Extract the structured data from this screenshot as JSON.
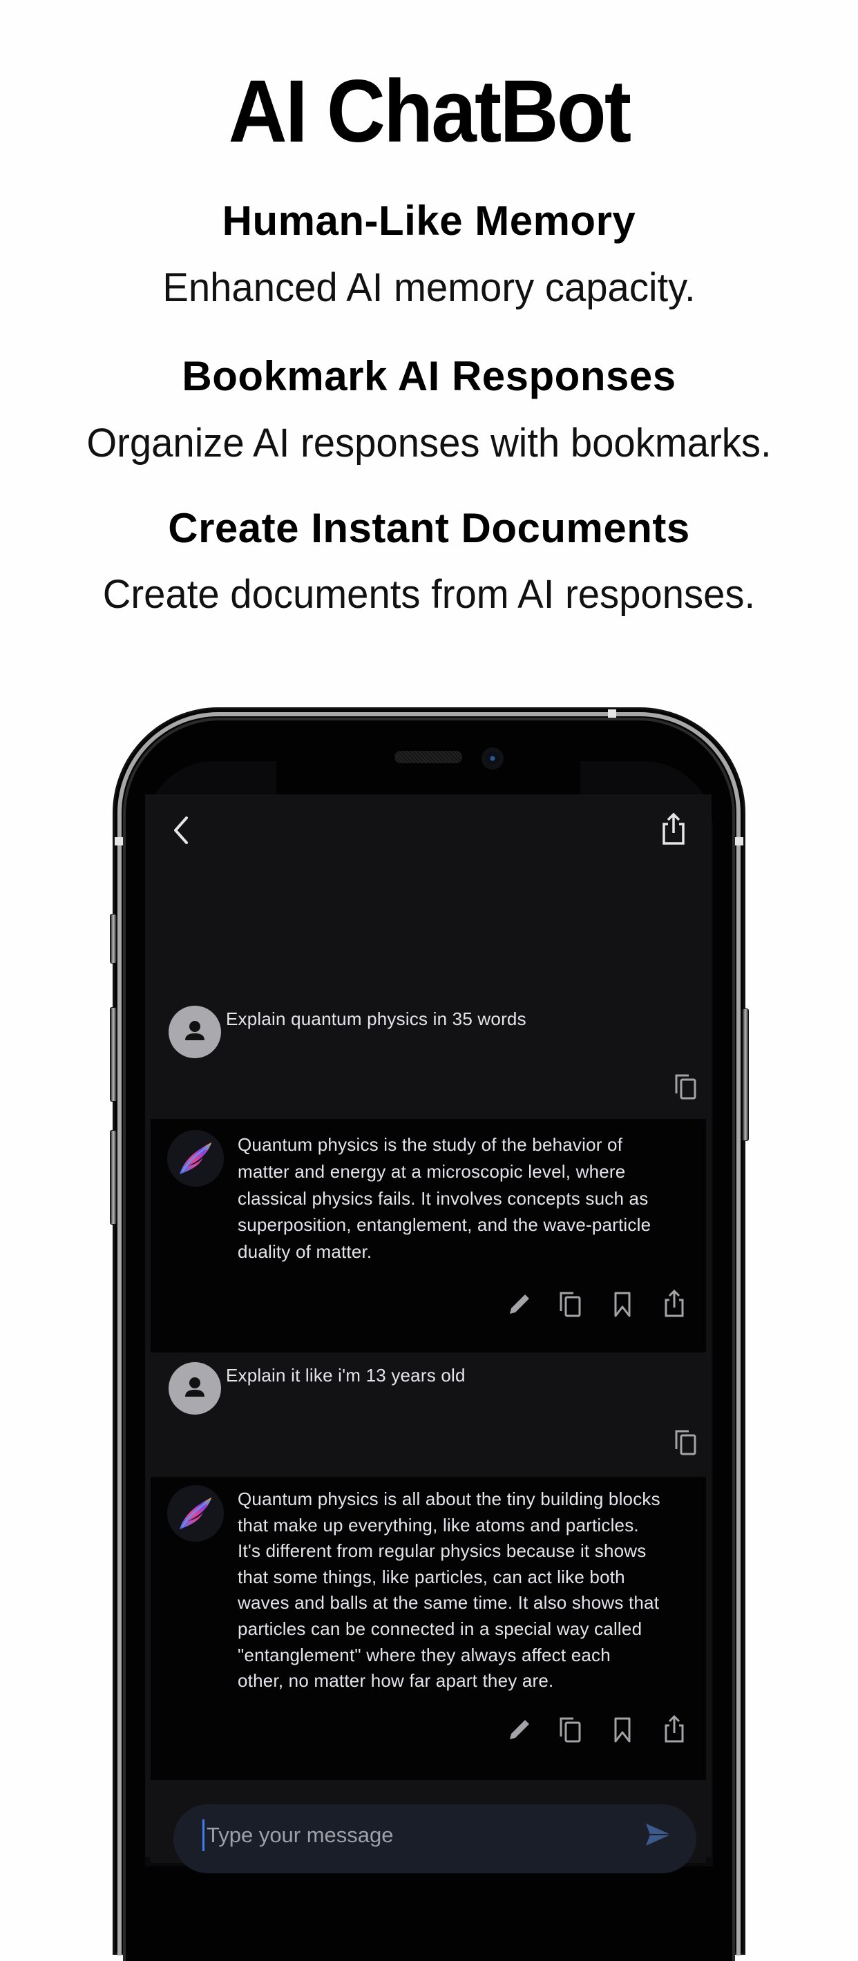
{
  "promo": {
    "title": "AI ChatBot",
    "features": [
      {
        "heading": "Human-Like Memory",
        "description": "Enhanced AI memory capacity."
      },
      {
        "heading": "Bookmark AI Responses",
        "description": "Organize AI responses with bookmarks."
      },
      {
        "heading": "Create Instant Documents",
        "description": "Create documents from AI responses."
      }
    ]
  },
  "app": {
    "nav": {
      "back_icon": "chevron-left-icon",
      "share_icon": "share-icon"
    },
    "messages": [
      {
        "role": "user",
        "text": "Explain quantum physics in 35 words",
        "actions": [
          "copy"
        ]
      },
      {
        "role": "assistant",
        "lines": [
          "Quantum physics is the study of the behavior of",
          "matter and energy at a microscopic level, where",
          "classical physics fails. It involves concepts such as",
          "superposition, entanglement, and the wave-particle",
          "duality of matter."
        ],
        "actions": [
          "edit",
          "copy",
          "bookmark",
          "share"
        ]
      },
      {
        "role": "user",
        "text": "Explain it like i'm 13 years old",
        "actions": [
          "copy"
        ]
      },
      {
        "role": "assistant",
        "lines": [
          "Quantum physics is all about the tiny building blocks",
          "that make up everything, like atoms and particles.",
          "It's different from regular physics because it shows",
          "that some things, like particles, can act like both",
          "waves and balls at the same time. It also shows that",
          "particles can be connected in a special way called",
          "\"entanglement\" where they always affect each",
          "other, no matter how far apart they are."
        ],
        "actions": [
          "edit",
          "copy",
          "bookmark",
          "share"
        ]
      }
    ],
    "input": {
      "placeholder": "Type your message",
      "value": "",
      "send_icon": "send-icon"
    },
    "colors": {
      "screen_bg": "#121215",
      "bot_bg": "#030304",
      "input_bg": "#1a1e29",
      "send": "#3d5a8c",
      "caret": "#3d7ef0",
      "user_avatar": "#aaa9ae"
    }
  }
}
